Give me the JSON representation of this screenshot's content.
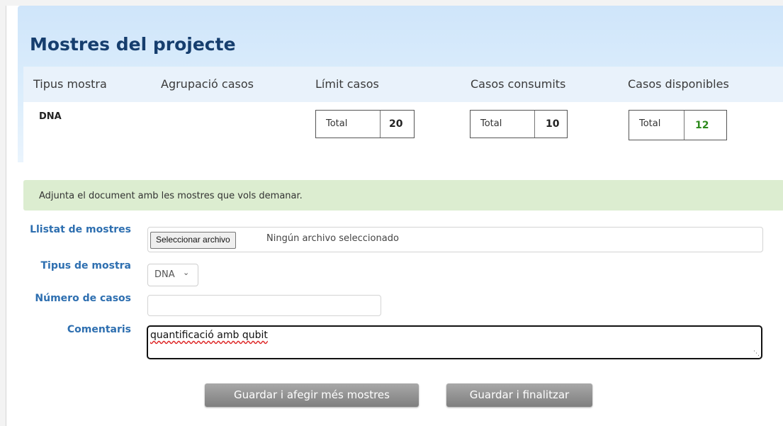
{
  "panel": {
    "title": "Mostres del projecte",
    "headers": [
      "Tipus mostra",
      "Agrupació casos",
      "Límit casos",
      "Casos consumits",
      "Casos disponibles"
    ],
    "row": {
      "sample_type": "DNA",
      "limit": {
        "label": "Total",
        "value": "20"
      },
      "consumed": {
        "label": "Total",
        "value": "10"
      },
      "available": {
        "label": "Total",
        "value": "12"
      }
    }
  },
  "notice": "Adjunta el document amb les mostres que vols demanar.",
  "form": {
    "file_label": "Llistat de mostres",
    "file_button": "Seleccionar archivo",
    "file_status": "Ningún archivo seleccionado",
    "type_label": "Tipus de mostra",
    "type_value": "DNA",
    "cases_label": "Número de casos",
    "cases_value": "",
    "comments_label": "Comentaris",
    "comments_value": "quantificació amb qubit"
  },
  "buttons": {
    "save_add": "Guardar i afegir més mostres",
    "save_finish": "Guardar i finalitzar"
  },
  "icons": {
    "select_chevron": "chevron-down-icon",
    "resize": "resize-grip-icon"
  },
  "colors": {
    "title": "#163e6e",
    "label": "#2e6fb0",
    "available_value": "#2d8a1c",
    "notice_bg": "#dcedd0"
  }
}
